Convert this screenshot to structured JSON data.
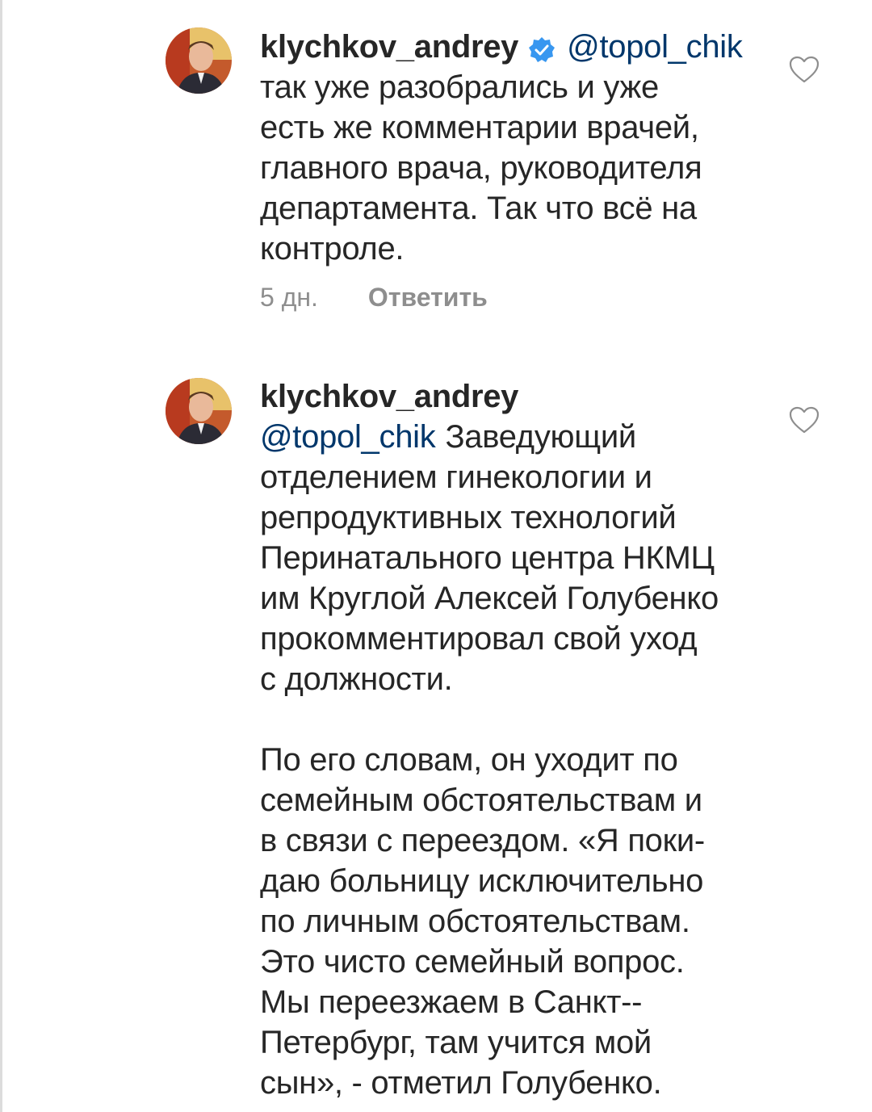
{
  "comments": [
    {
      "username": "klychkov_andrey",
      "verified": true,
      "mention": "@topol_chik",
      "text": "так уже разобрались и уже\nесть же комментарии врачей,\nглавного врача, руководителя\nдепартамента. Так что всё на\nконтроле.",
      "time": "5 дн.",
      "reply_label": "Ответить"
    },
    {
      "username": "klychkov_andrey",
      "verified": false,
      "mention": "@topol_chik",
      "text_first": "Заведующий",
      "text": "отделением гинекологии и\nрепродуктивных технологий\nПеринатального центра НКМЦ\nим Круглой Алексей Голубенко\nпрокомментировал свой уход\nс должности.\n\nПо его словам, он уходит по\nсемейным обстоятельствам и\nв связи с переездом. «Я поки-\nдаю больницу исключительно\nпо личным обстоятельствам.\nЭто чисто семейный вопрос.\nМы переезжаем в Санкт-‐\nПетербург, там учится мой\nсын», - отметил Голубенко."
    }
  ],
  "colors": {
    "text": "#262626",
    "mention": "#00376b",
    "meta": "#8e8e8e",
    "verified": "#3897f0"
  },
  "icons": {
    "verified": "verified-badge-icon",
    "like": "heart-outline-icon"
  }
}
